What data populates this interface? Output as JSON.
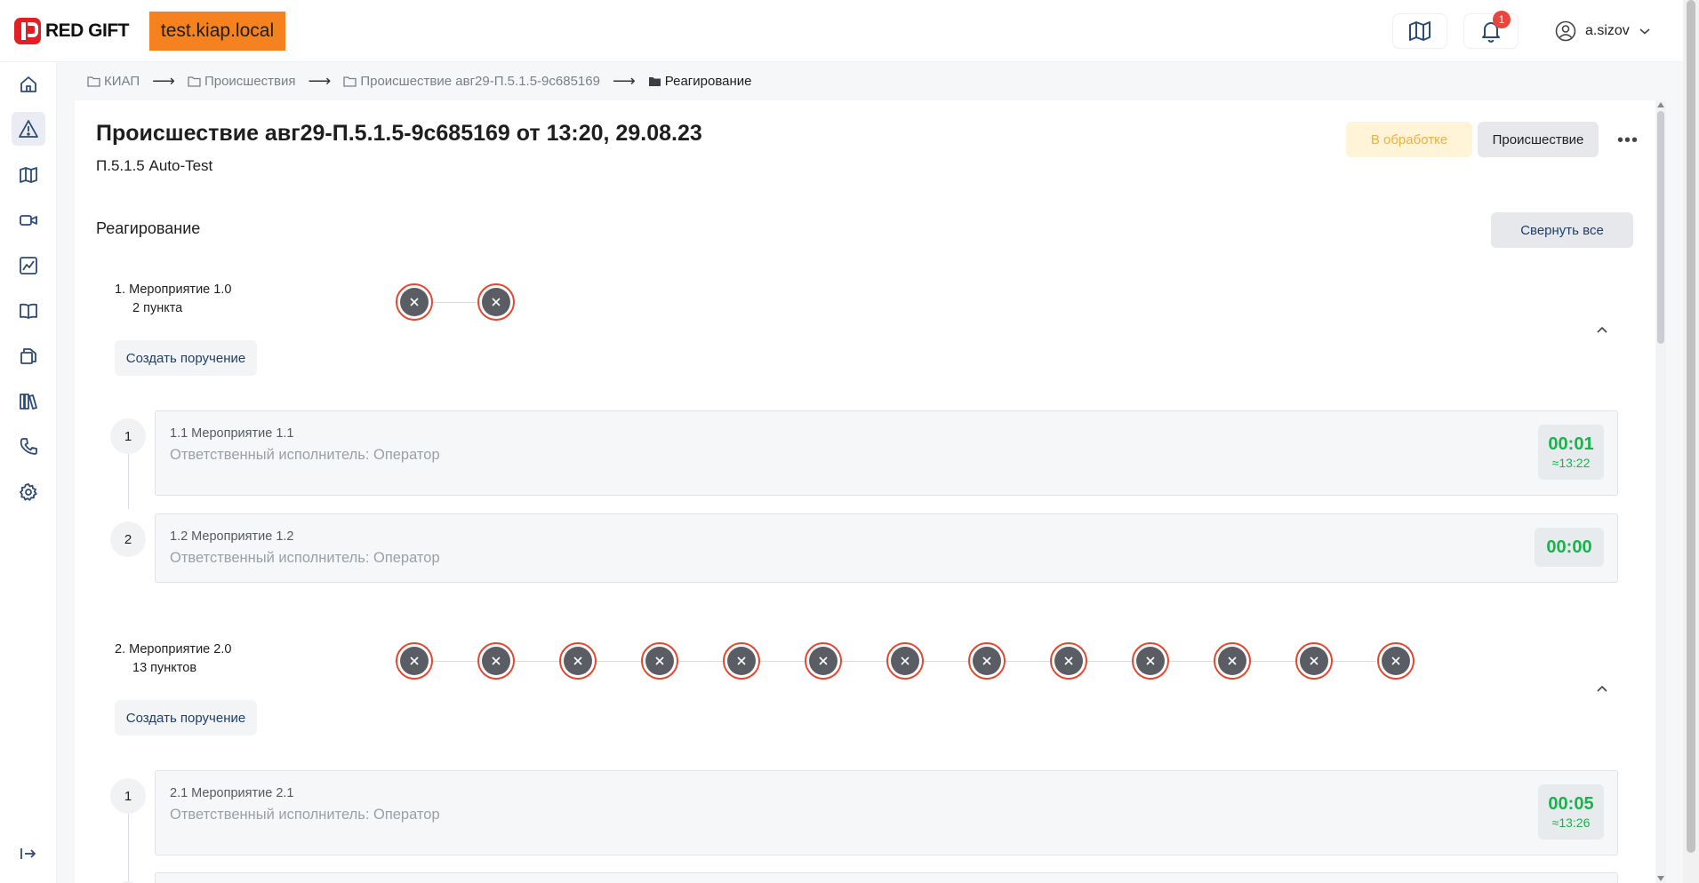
{
  "app": {
    "logo_text": "RED GIFT",
    "environment": "test.kiap.local",
    "notifications_count": "1",
    "user_name": "a.sizov"
  },
  "colors": {
    "accent_red": "#e31e24",
    "env_badge": "#f5821f",
    "status_pending_text": "#f0b03a",
    "timer_green": "#19b24b",
    "step_ring": "#e5472f"
  },
  "icons": {
    "topbar": [
      "map-icon",
      "bell-icon",
      "user-icon",
      "chevron-down-icon"
    ],
    "sidebar": [
      "home-icon",
      "alert-icon",
      "map-icon",
      "camera-icon",
      "chart-icon",
      "book-icon",
      "files-icon",
      "library-icon",
      "phone-icon",
      "gear-icon",
      "logout-icon"
    ]
  },
  "breadcrumb": {
    "items": [
      "КИАП",
      "Происшествия",
      "Происшествие авг29-П.5.1.5-9c685169",
      "Реагирование"
    ]
  },
  "incident": {
    "title": "Происшествие авг29-П.5.1.5-9c685169 от 13:20, 29.08.23",
    "subtitle": "П.5.1.5 Auto-Test",
    "status": "В обработке",
    "type_label": "Происшествие"
  },
  "response": {
    "section_title": "Реагирование",
    "collapse_all_label": "Свернуть все",
    "events": [
      {
        "name": "1. Мероприятие 1.0",
        "count": "2 пункта",
        "create_task_label": "Создать поручение",
        "steps_total": 2,
        "tasks": [
          {
            "number": "1",
            "title": "1.1 Мероприятие 1.1",
            "responsible": "Ответственный исполнитель: Оператор",
            "timer": "00:01",
            "eta": "≈13:22"
          },
          {
            "number": "2",
            "title": "1.2 Мероприятие 1.2",
            "responsible": "Ответственный исполнитель: Оператор",
            "timer": "00:00",
            "eta": ""
          }
        ]
      },
      {
        "name": "2. Мероприятие 2.0",
        "count": "13 пунктов",
        "create_task_label": "Создать поручение",
        "steps_total": 13,
        "tasks": [
          {
            "number": "1",
            "title": "2.1 Мероприятие 2.1",
            "responsible": "Ответственный исполнитель: Оператор",
            "timer": "00:05",
            "eta": "≈13:26"
          }
        ]
      }
    ]
  }
}
